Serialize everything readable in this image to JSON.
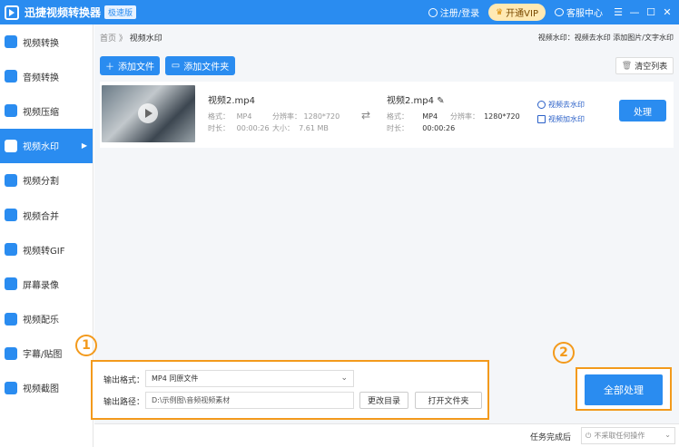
{
  "app": {
    "title": "迅捷视频转换器",
    "badge": "极速版"
  },
  "titlebar": {
    "login": "注册/登录",
    "vip": "开通VIP",
    "service": "客服中心",
    "minimize": "—",
    "maximize": "☐",
    "close": "✕"
  },
  "sidebar": {
    "items": [
      {
        "label": "视频转换"
      },
      {
        "label": "音频转换"
      },
      {
        "label": "视频压缩"
      },
      {
        "label": "视频水印"
      },
      {
        "label": "视频分割"
      },
      {
        "label": "视频合并"
      },
      {
        "label": "视频转GIF"
      },
      {
        "label": "屏幕录像"
      },
      {
        "label": "视频配乐"
      },
      {
        "label": "字幕/贴图"
      },
      {
        "label": "视频截图"
      }
    ],
    "active_index": 3
  },
  "breadcrumb": {
    "home": "首页",
    "sep": "》",
    "current": "视频水印"
  },
  "feature_links": "视频水印：视频去水印 添加图片/文字水印",
  "toolbar": {
    "add_file": "添加文件",
    "add_folder": "添加文件夹",
    "clear_list": "清空列表"
  },
  "file": {
    "source": {
      "name": "视频2.mp4",
      "format_label": "格式：",
      "format": "MP4",
      "res_label": "分辨率：",
      "res": "1280*720",
      "duration_label": "时长：",
      "duration": "00:00:26",
      "size_label": "大小：",
      "size": "7.61 MB"
    },
    "target": {
      "name": "视频2.mp4",
      "format_label": "格式：",
      "format": "MP4",
      "res_label": "分辨率：",
      "res": "1280*720",
      "duration_label": "时长：",
      "duration": "00:00:26"
    },
    "remove_wm": "视频去水印",
    "add_wm": "视频加水印",
    "process": "处理"
  },
  "output": {
    "format_label": "输出格式：",
    "format_value": "MP4  同原文件",
    "path_label": "输出路径：",
    "path_value": "D:\\示例图\\音频视频素材",
    "change_dir": "更改目录",
    "open_folder": "打开文件夹"
  },
  "markers": {
    "one": "1",
    "two": "2"
  },
  "process_all": "全部处理",
  "footer": {
    "done_label": "任务完成后",
    "done_option": "不采取任何操作"
  }
}
